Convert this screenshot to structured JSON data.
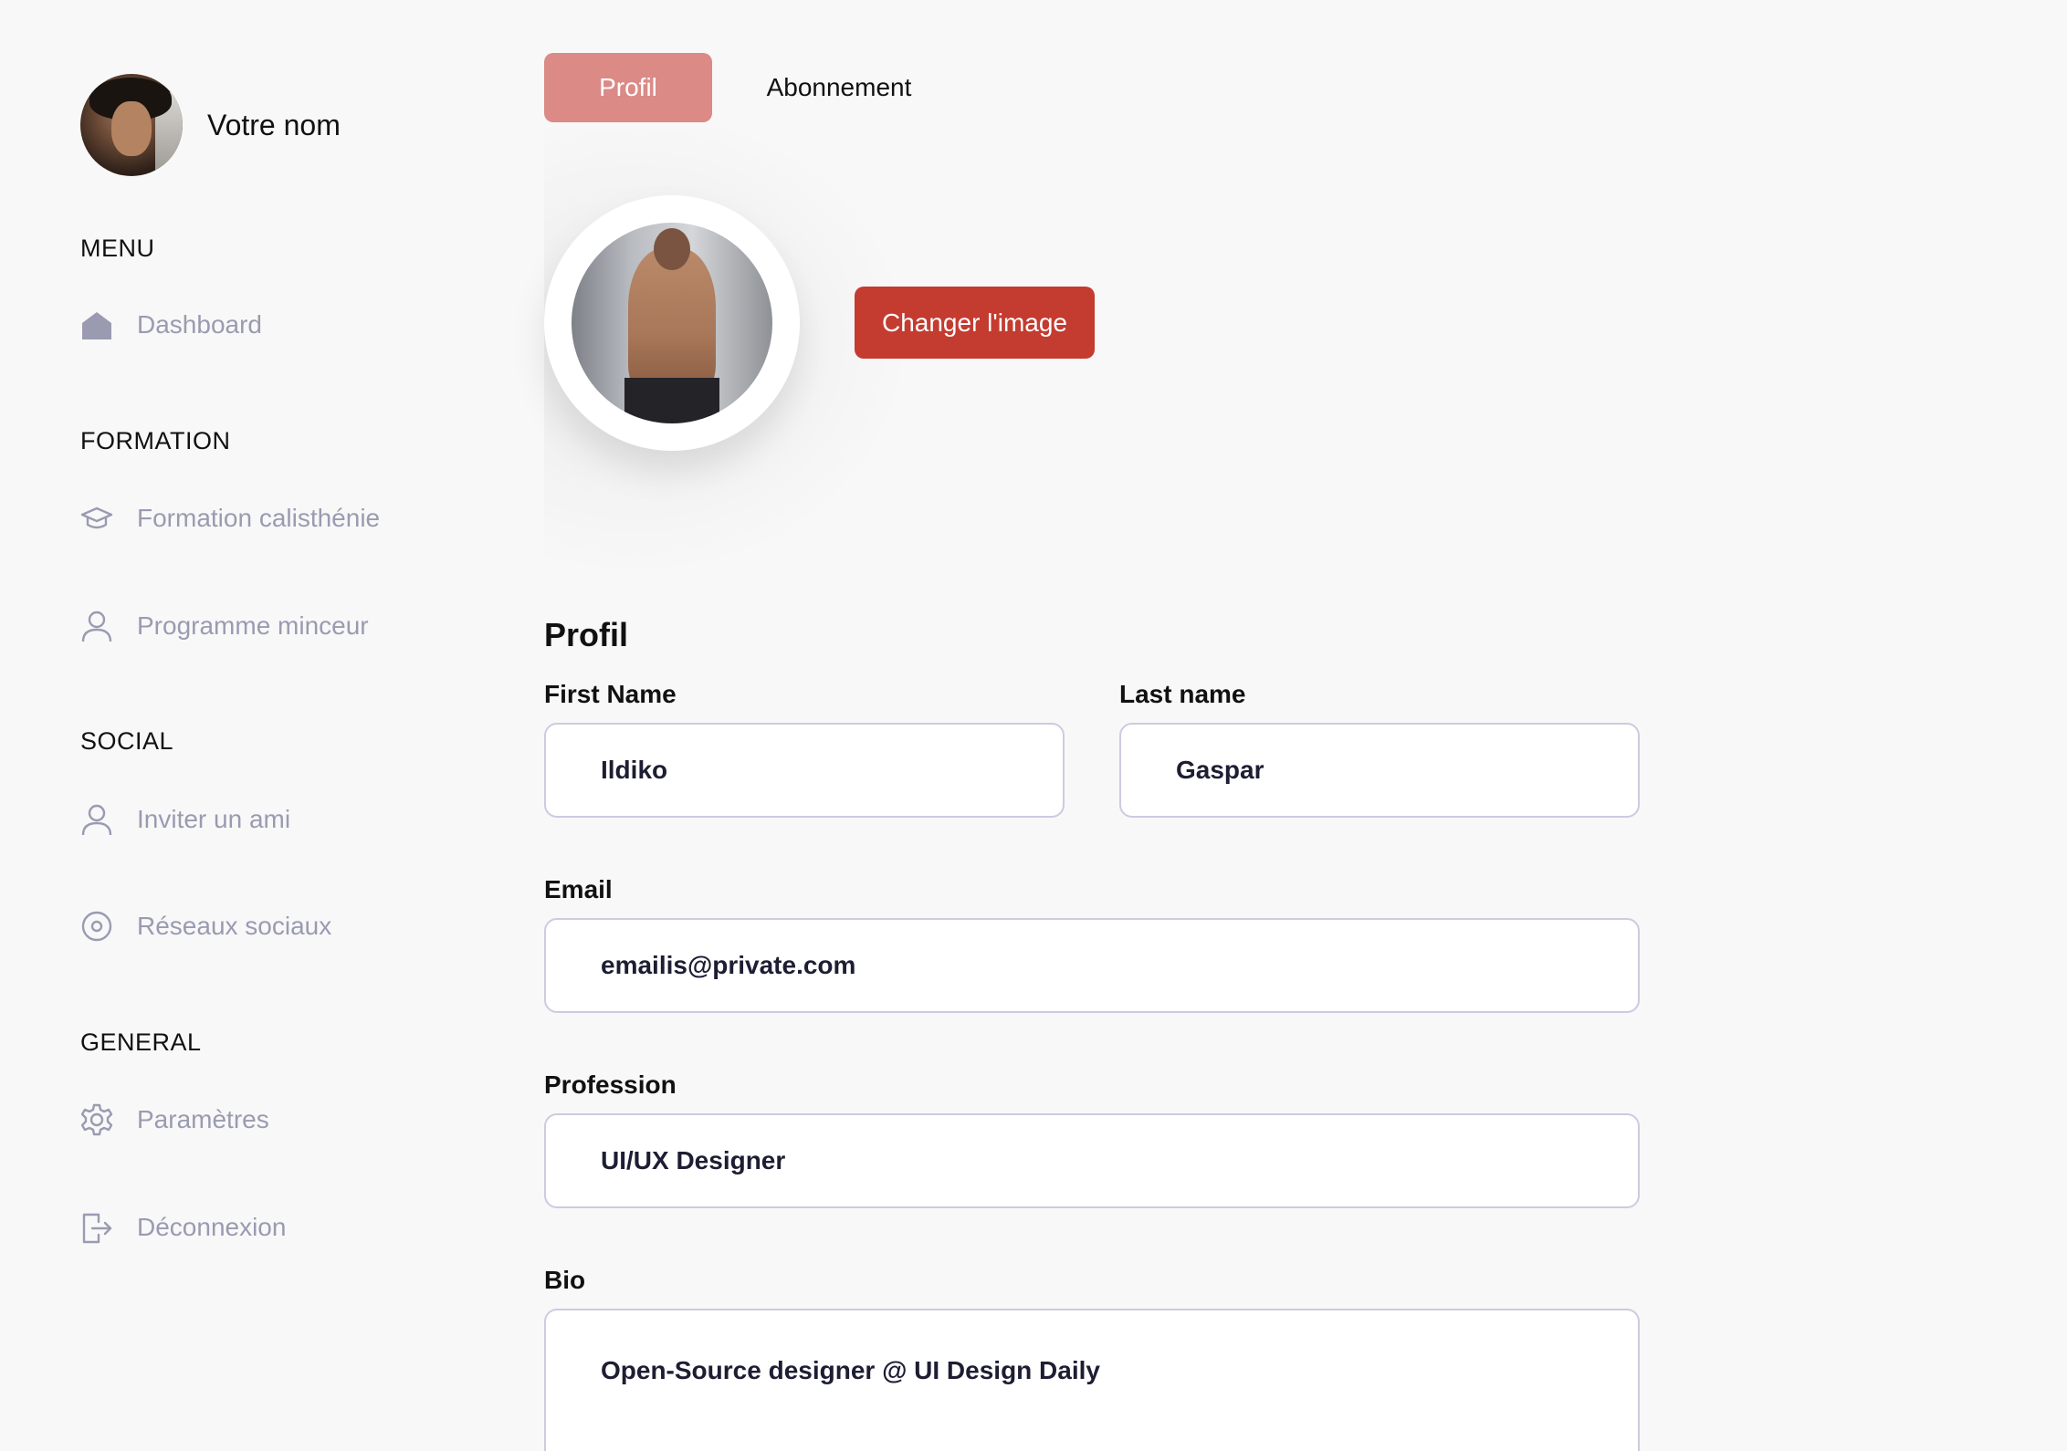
{
  "sidebar": {
    "user_name": "Votre nom",
    "sections": {
      "menu": "MENU",
      "formation": "FORMATION",
      "social": "SOCIAL",
      "general": "GENERAL"
    },
    "items": {
      "dashboard": {
        "label": "Dashboard",
        "icon": "home-icon"
      },
      "formation_calisthenie": {
        "label": "Formation calisthénie",
        "icon": "graduation-cap-icon"
      },
      "programme_minceur": {
        "label": "Programme minceur",
        "icon": "user-icon"
      },
      "inviter_ami": {
        "label": "Inviter un ami",
        "icon": "user-icon"
      },
      "reseaux_sociaux": {
        "label": "Réseaux sociaux",
        "icon": "circle-dot-icon"
      },
      "parametres": {
        "label": "Paramètres",
        "icon": "gear-icon"
      },
      "deconnexion": {
        "label": "Déconnexion",
        "icon": "logout-icon"
      }
    }
  },
  "tabs": {
    "profil": "Profil",
    "abonnement": "Abonnement"
  },
  "avatar": {
    "change_button": "Changer l'image"
  },
  "form": {
    "title": "Profil",
    "first_name": {
      "label": "First Name",
      "value": "Ildiko"
    },
    "last_name": {
      "label": "Last name",
      "value": "Gaspar"
    },
    "email": {
      "label": "Email",
      "value": "emailis@private.com"
    },
    "profession": {
      "label": "Profession",
      "value": "UI/UX Designer"
    },
    "bio": {
      "label": "Bio",
      "value": "Open-Source designer @ UI Design Daily"
    }
  },
  "colors": {
    "background": "#f8f8f8",
    "tab_active": "#db8a86",
    "primary_button": "#c43b30",
    "nav_text": "#9a9bb1",
    "field_border": "#cdcbe0"
  }
}
